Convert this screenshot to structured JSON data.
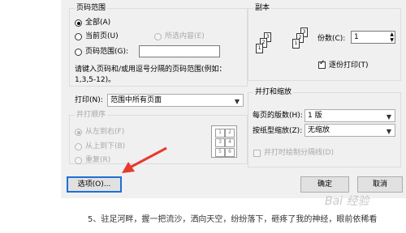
{
  "page_range": {
    "title": "页码范围",
    "all": "全部(A)",
    "current_page": "当前页(U)",
    "selection": "所选内容(E)",
    "page_numbers": "页码范围(G):",
    "page_numbers_value": "",
    "hint_line1": "请键入页码和/或用逗号分隔的页码范围(例如：",
    "hint_line2": "1,3,5-12)。"
  },
  "print_what": {
    "label": "打印(N):",
    "value": "范围中所有页面"
  },
  "print_order": {
    "title": "并打顺序",
    "left_to_right": "从左到右(F)",
    "top_to_bottom": "从上到下(B)",
    "repeat": "重复(R)",
    "grid": [
      "1",
      "2",
      "3",
      "4",
      "5",
      "6"
    ]
  },
  "copies": {
    "title": "副本",
    "count_label": "份数(C):",
    "count_value": "1",
    "collate_label": "逐份打印(T)",
    "collate_checked": true,
    "page_labels": [
      "3",
      "2",
      "1"
    ]
  },
  "zoom": {
    "title": "并打和缩放",
    "pages_per_sheet_label": "每页的版数(H):",
    "pages_per_sheet_value": "1 版",
    "scale_label": "按纸型缩放(Z):",
    "scale_value": "无缩放",
    "draw_borders": "并打时绘制分隔线(D)"
  },
  "buttons": {
    "options": "选项(O)...",
    "ok": "确定",
    "cancel": "取消"
  },
  "page_text": "5、驻足河畔，握一把流沙，洒向天空，纷纷落下，砸疼了我的神经，眼前依稀看",
  "watermark": "Bai 经验",
  "colors": {
    "accent": "#1e6fd6",
    "arrow": "#e53b2c",
    "dialog_bg": "#f0f0f0"
  }
}
